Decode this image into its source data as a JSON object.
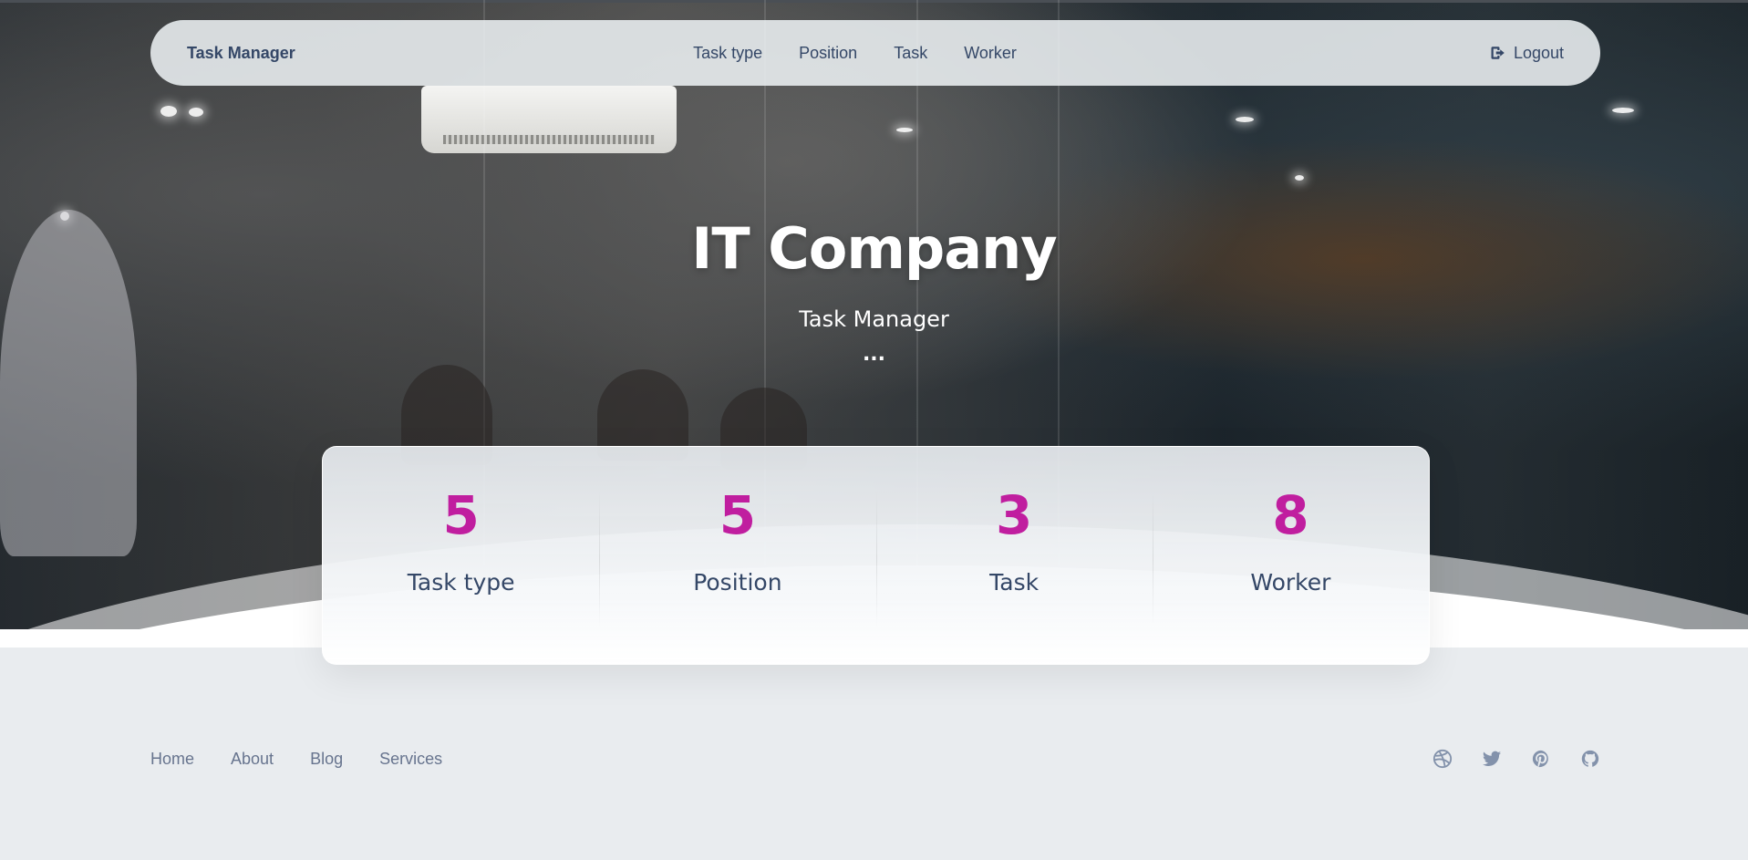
{
  "navbar": {
    "brand": "Task Manager",
    "links": [
      "Task type",
      "Position",
      "Task",
      "Worker"
    ],
    "logout_label": "Logout"
  },
  "hero": {
    "title": "IT Company",
    "subtitle": "Task Manager",
    "dots": "..."
  },
  "stats": [
    {
      "value": "5",
      "label": "Task type"
    },
    {
      "value": "5",
      "label": "Position"
    },
    {
      "value": "3",
      "label": "Task"
    },
    {
      "value": "8",
      "label": "Worker"
    }
  ],
  "footer": {
    "links": [
      "Home",
      "About",
      "Blog",
      "Services"
    ],
    "social_icons": [
      "dribbble-icon",
      "twitter-icon",
      "pinterest-icon",
      "github-icon"
    ]
  },
  "colors": {
    "stat_value": "#c01e9f",
    "text_dark": "#344767",
    "text_muted": "#67748e",
    "footer_bg": "#e9ecef"
  }
}
